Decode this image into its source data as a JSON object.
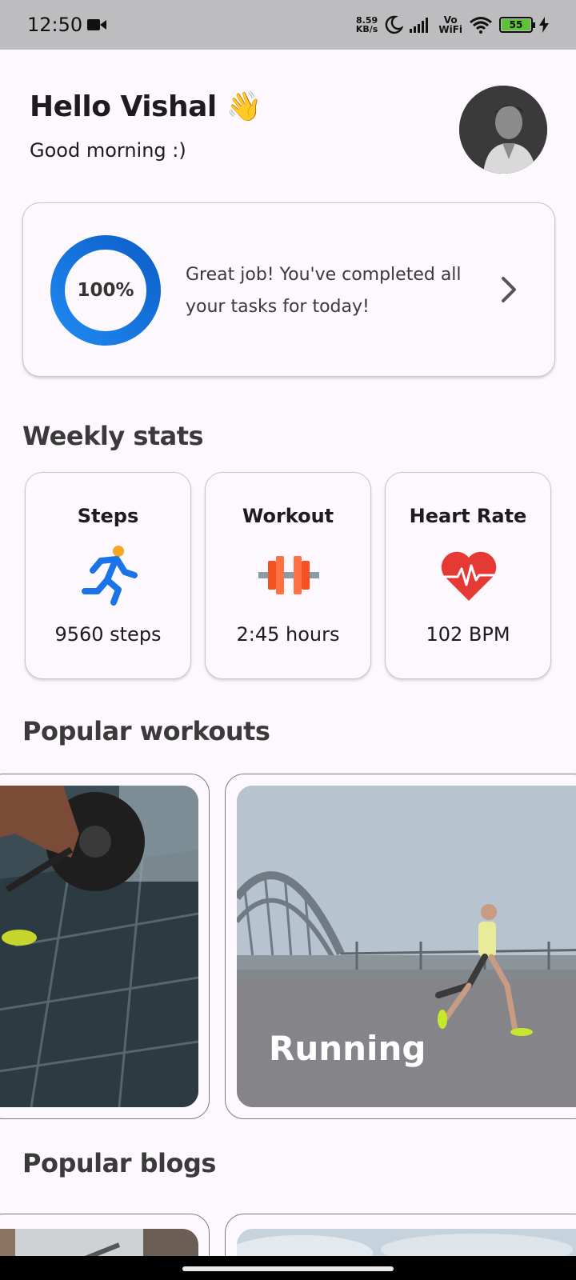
{
  "status_bar": {
    "time": "12:50",
    "net_speed_value": "8.59",
    "net_speed_unit": "KB/s",
    "vowifi_top": "Vo",
    "vowifi_bottom": "WiFi",
    "battery": "55"
  },
  "header": {
    "greeting": "Hello Vishal 👋",
    "subtitle": "Good morning :)"
  },
  "progress_card": {
    "percent_label": "100%",
    "progress_fraction": 1.0,
    "message": "Great job! You've completed all your tasks for today!"
  },
  "weekly_stats": {
    "title": "Weekly stats",
    "cards": [
      {
        "title": "Steps",
        "value": "9560 steps",
        "icon": "running-icon"
      },
      {
        "title": "Workout",
        "value": "2:45 hours",
        "icon": "dumbbell-icon"
      },
      {
        "title": "Heart Rate",
        "value": "102 BPM",
        "icon": "heart-rate-icon"
      }
    ]
  },
  "popular_workouts": {
    "title": "Popular workouts",
    "items": [
      {
        "label": ""
      },
      {
        "label": "Running"
      }
    ]
  },
  "popular_blogs": {
    "title": "Popular blogs"
  },
  "colors": {
    "accent_blue": "#1a73e8",
    "background": "#fdf8fd",
    "battery_green": "#5ec239",
    "heart_red": "#e53935",
    "dumbbell_orange": "#f4511e"
  }
}
